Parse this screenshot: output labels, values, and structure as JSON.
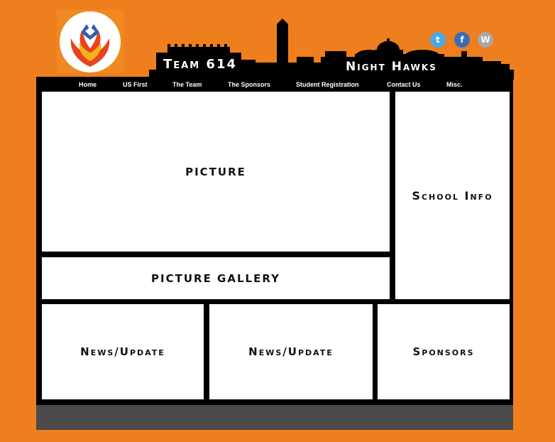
{
  "header": {
    "team_title": "Team 614",
    "team_name": "Night Hawks"
  },
  "social": [
    {
      "icon": "twitter-icon",
      "glyph": "t",
      "color": "#4AA9E4"
    },
    {
      "icon": "facebook-icon",
      "glyph": "f",
      "color": "#3C6BB8"
    },
    {
      "icon": "wordpress-icon",
      "glyph": "W",
      "color": "#A7A7A7"
    }
  ],
  "nav": {
    "items": [
      "Home",
      "US First",
      "The Team",
      "The Sponsors",
      "Student Registration",
      "Contact Us",
      "Misc."
    ]
  },
  "panels": {
    "picture": "PICTURE",
    "gallery": "PICTURE GALLERY",
    "school_info": "School Info",
    "news1": "News/Update",
    "news2": "News/Update",
    "sponsors": "Sponsors"
  },
  "colors": {
    "background": "#EF7F1E",
    "frame": "#000000",
    "footer": "#4A4A4A"
  }
}
